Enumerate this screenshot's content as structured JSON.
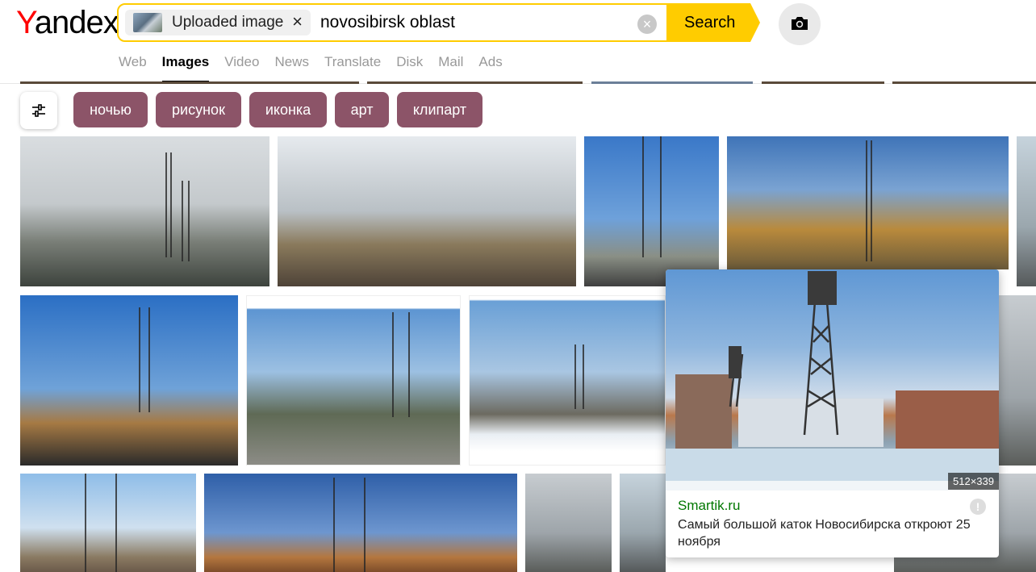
{
  "header": {
    "logo_first": "Y",
    "logo_rest": "andex",
    "image_chip_label": "Uploaded image",
    "image_chip_close": "×",
    "query": "novosibirsk oblast",
    "clear": "×",
    "search_label": "Search"
  },
  "nav": {
    "items": [
      {
        "label": "Web",
        "active": false
      },
      {
        "label": "Images",
        "active": true
      },
      {
        "label": "Video",
        "active": false
      },
      {
        "label": "News",
        "active": false
      },
      {
        "label": "Translate",
        "active": false
      },
      {
        "label": "Disk",
        "active": false
      },
      {
        "label": "Mail",
        "active": false
      },
      {
        "label": "Ads",
        "active": false
      }
    ]
  },
  "filters": {
    "tags": [
      "ночью",
      "рисунок",
      "иконка",
      "арт",
      "клипарт"
    ]
  },
  "preview": {
    "size": "512×339",
    "source": "Smartik.ru",
    "title": "Самый большой каток Новосибирска откроют 25 ноября",
    "alert": "!"
  },
  "colors": {
    "accent": "#ffcc00",
    "tag_bg": "#8c5468",
    "source_link": "#007700",
    "logo_red": "#ff0000"
  }
}
